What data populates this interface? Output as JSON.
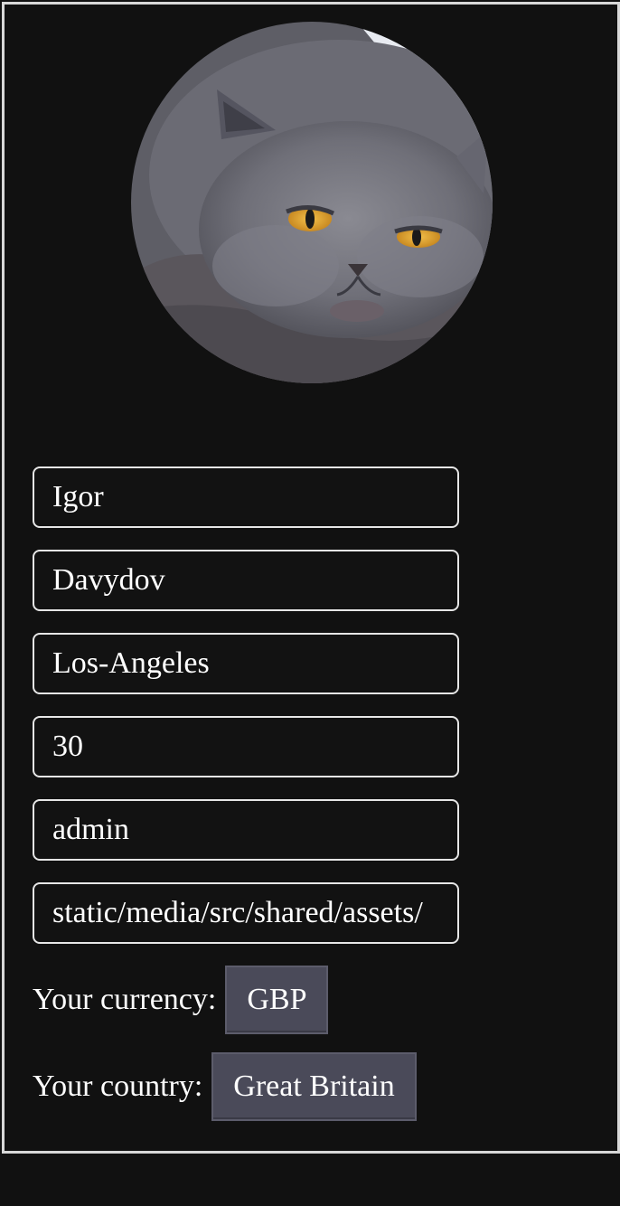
{
  "profile": {
    "avatar_alt": "British shorthair cat",
    "fields": [
      {
        "name": "first-name-field",
        "value": "Igor"
      },
      {
        "name": "last-name-field",
        "value": "Davydov"
      },
      {
        "name": "city-field",
        "value": "Los-Angeles"
      },
      {
        "name": "age-field",
        "value": "30"
      },
      {
        "name": "role-field",
        "value": "admin"
      },
      {
        "name": "avatar-path-field",
        "value": "static/media/src/shared/assets/"
      }
    ],
    "currency_label": "Your currency:",
    "currency_value": "GBP",
    "country_label": "Your country:",
    "country_value": "Great Britain"
  },
  "colors": {
    "background": "#111111",
    "frame_border": "#d8d8d8",
    "field_border": "#e6e6e6",
    "pill_bg": "#4a4a59",
    "cat_eye": "#e0a23a"
  }
}
